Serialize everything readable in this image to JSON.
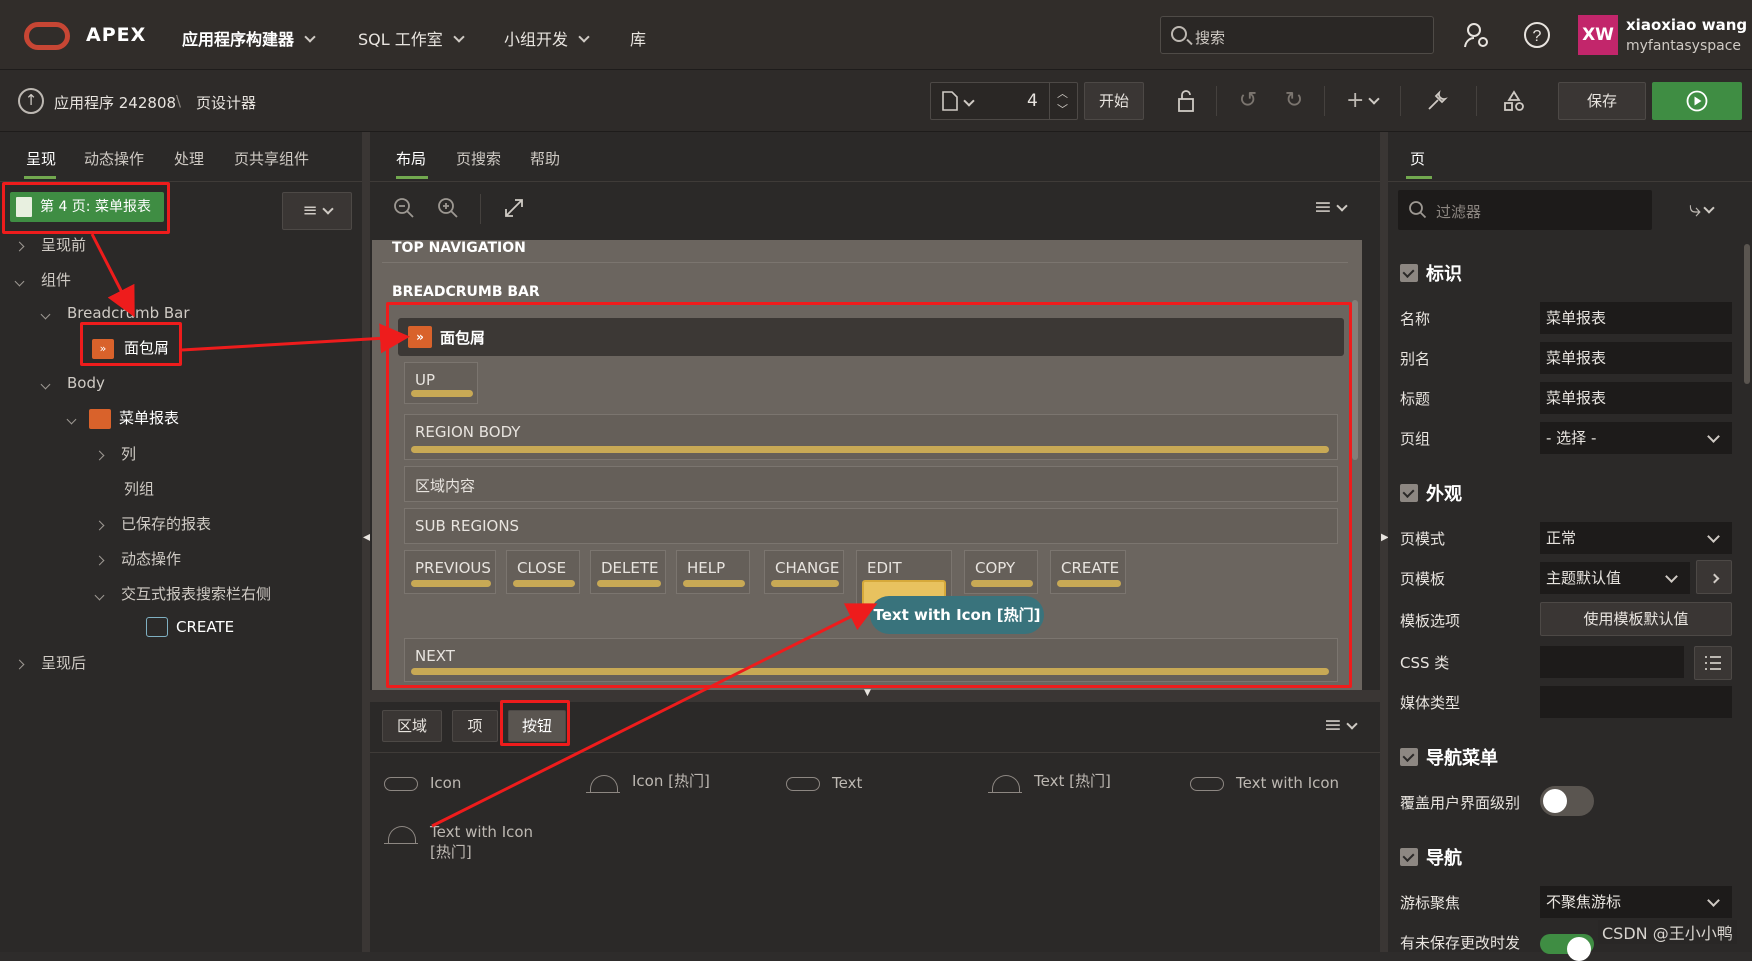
{
  "header": {
    "brand": "APEX",
    "nav": [
      {
        "label": "应用程序构建器",
        "dropdown": true
      },
      {
        "label": "SQL 工作室",
        "dropdown": true
      },
      {
        "label": "小组开发",
        "dropdown": true
      },
      {
        "label": "库",
        "dropdown": false
      }
    ],
    "search_placeholder": "搜索",
    "user": {
      "initials": "XW",
      "name": "xiaoxiao wang",
      "workspace": "myfantasyspace"
    }
  },
  "toolbar": {
    "app_label": "应用程序 242808",
    "separator": "\\",
    "page_designer": "页设计器",
    "page_number": "4",
    "go_button": "开始",
    "save_button": "保存"
  },
  "left_panel": {
    "tabs": [
      "呈现",
      "动态操作",
      "处理",
      "页共享组件"
    ],
    "active_tab": 0,
    "page_chip": "第 4 页: 菜单报表",
    "tree": [
      {
        "label": "呈现前",
        "state": "collapsed"
      },
      {
        "label": "组件",
        "state": "expanded"
      },
      {
        "label": "Breadcrumb Bar",
        "state": "expanded"
      },
      {
        "label": "面包屑",
        "state": "leaf"
      },
      {
        "label": "Body",
        "state": "expanded"
      },
      {
        "label": "菜单报表",
        "state": "expanded"
      },
      {
        "label": "列",
        "state": "collapsed"
      },
      {
        "label": "列组",
        "state": "leaf"
      },
      {
        "label": "已保存的报表",
        "state": "collapsed"
      },
      {
        "label": "动态操作",
        "state": "collapsed"
      },
      {
        "label": "交互式报表搜索栏右侧",
        "state": "expanded"
      },
      {
        "label": "CREATE",
        "state": "leaf"
      },
      {
        "label": "呈现后",
        "state": "collapsed"
      }
    ]
  },
  "center_panel": {
    "tabs": [
      "布局",
      "页搜索",
      "帮助"
    ],
    "active_tab": 0,
    "regions": {
      "top_navigation": "TOP NAVIGATION",
      "breadcrumb_bar": "BREADCRUMB BAR",
      "breadcrumb_title": "面包屑",
      "up": "UP",
      "region_body": "REGION BODY",
      "region_content": "区域内容",
      "sub_regions": "SUB REGIONS",
      "buttons": [
        "PREVIOUS",
        "CLOSE",
        "DELETE",
        "HELP",
        "CHANGE",
        "EDIT",
        "COPY",
        "CREATE"
      ],
      "next": "NEXT"
    },
    "tooltip": "Text with Icon [热门]",
    "gallery_tabs": [
      "区域",
      "项",
      "按钮"
    ],
    "gallery_active_tab": 2,
    "gallery_items": [
      {
        "label": "Icon",
        "icon": "pill-icon"
      },
      {
        "label": "Icon [热门]",
        "icon": "flame-icon"
      },
      {
        "label": "Text",
        "icon": "pill-icon"
      },
      {
        "label": "Text [热门]",
        "icon": "flame-icon"
      },
      {
        "label": "Text with Icon",
        "icon": "pill-icon"
      },
      {
        "label": "Text with Icon [热门]",
        "icon": "flame-icon"
      }
    ]
  },
  "right_panel": {
    "tab": "页",
    "filter_placeholder": "过滤器",
    "sections": {
      "identification": "标识",
      "appearance": "外观",
      "navigation_menu": "导航菜单",
      "navigation": "导航"
    },
    "props": {
      "name_label": "名称",
      "name_value": "菜单报表",
      "alias_label": "别名",
      "alias_value": "菜单报表",
      "title_label": "标题",
      "title_value": "菜单报表",
      "group_label": "页组",
      "group_value": "- 选择 -",
      "mode_label": "页模式",
      "mode_value": "正常",
      "template_label": "页模板",
      "template_value": "主题默认值",
      "template_opts_label": "模板选项",
      "template_opts_button": "使用模板默认值",
      "css_label": "CSS 类",
      "css_value": "",
      "media_label": "媒体类型",
      "media_value": "",
      "override_label": "覆盖用户界面级别",
      "cursor_label": "游标聚焦",
      "cursor_value": "不聚焦游标",
      "unsaved_label": "有未保存更改时发"
    }
  },
  "watermark": "CSDN @王小小鸭",
  "colors": {
    "accent_green": "#3f8d43",
    "annotation_red": "#ee1c1c",
    "button_bar_gold": "#c8a955",
    "tooltip_teal": "#39737c",
    "oracle_red": "#c74634"
  }
}
